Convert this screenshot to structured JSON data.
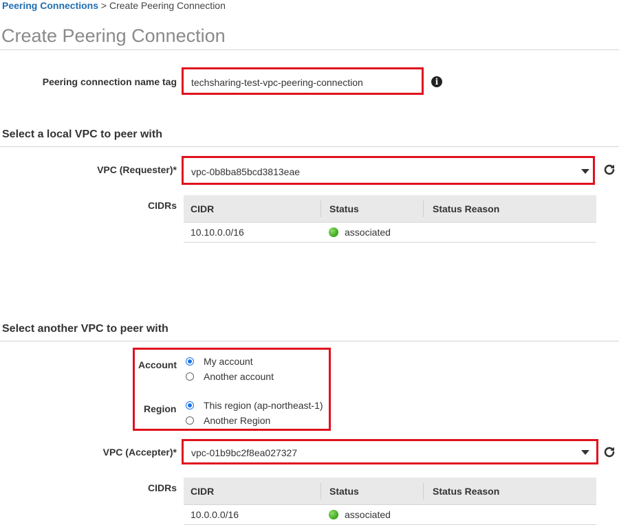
{
  "breadcrumb": {
    "parent": "Peering Connections",
    "separator": ">",
    "current": "Create Peering Connection"
  },
  "page_title": "Create Peering Connection",
  "name_tag": {
    "label": "Peering connection name tag",
    "value": "techsharing-test-vpc-peering-connection",
    "info_icon": "info-icon"
  },
  "local_section": {
    "title": "Select a local VPC to peer with",
    "vpc_label": "VPC (Requester)*",
    "vpc_value": "vpc-0b8ba85bcd3813eae",
    "cidrs_label": "CIDRs",
    "table": {
      "headers": [
        "CIDR",
        "Status",
        "Status Reason"
      ],
      "rows": [
        {
          "cidr": "10.10.0.0/16",
          "status": "associated",
          "reason": ""
        }
      ]
    }
  },
  "another_section": {
    "title": "Select another VPC to peer with",
    "account_label": "Account",
    "account_options": [
      {
        "label": "My account",
        "selected": true
      },
      {
        "label": "Another account",
        "selected": false
      }
    ],
    "region_label": "Region",
    "region_options": [
      {
        "label": "This region (ap-northeast-1)",
        "selected": true
      },
      {
        "label": "Another Region",
        "selected": false
      }
    ],
    "vpc_label": "VPC (Accepter)*",
    "vpc_value": "vpc-01b9bc2f8ea027327",
    "cidrs_label": "CIDRs",
    "table": {
      "headers": [
        "CIDR",
        "Status",
        "Status Reason"
      ],
      "rows": [
        {
          "cidr": "10.0.0.0/16",
          "status": "associated",
          "reason": ""
        }
      ]
    }
  },
  "colors": {
    "link": "#1f6fb2",
    "highlight": "#e0101e",
    "radio_on": "#1a73e8",
    "status_ok": "#3aa41a"
  }
}
